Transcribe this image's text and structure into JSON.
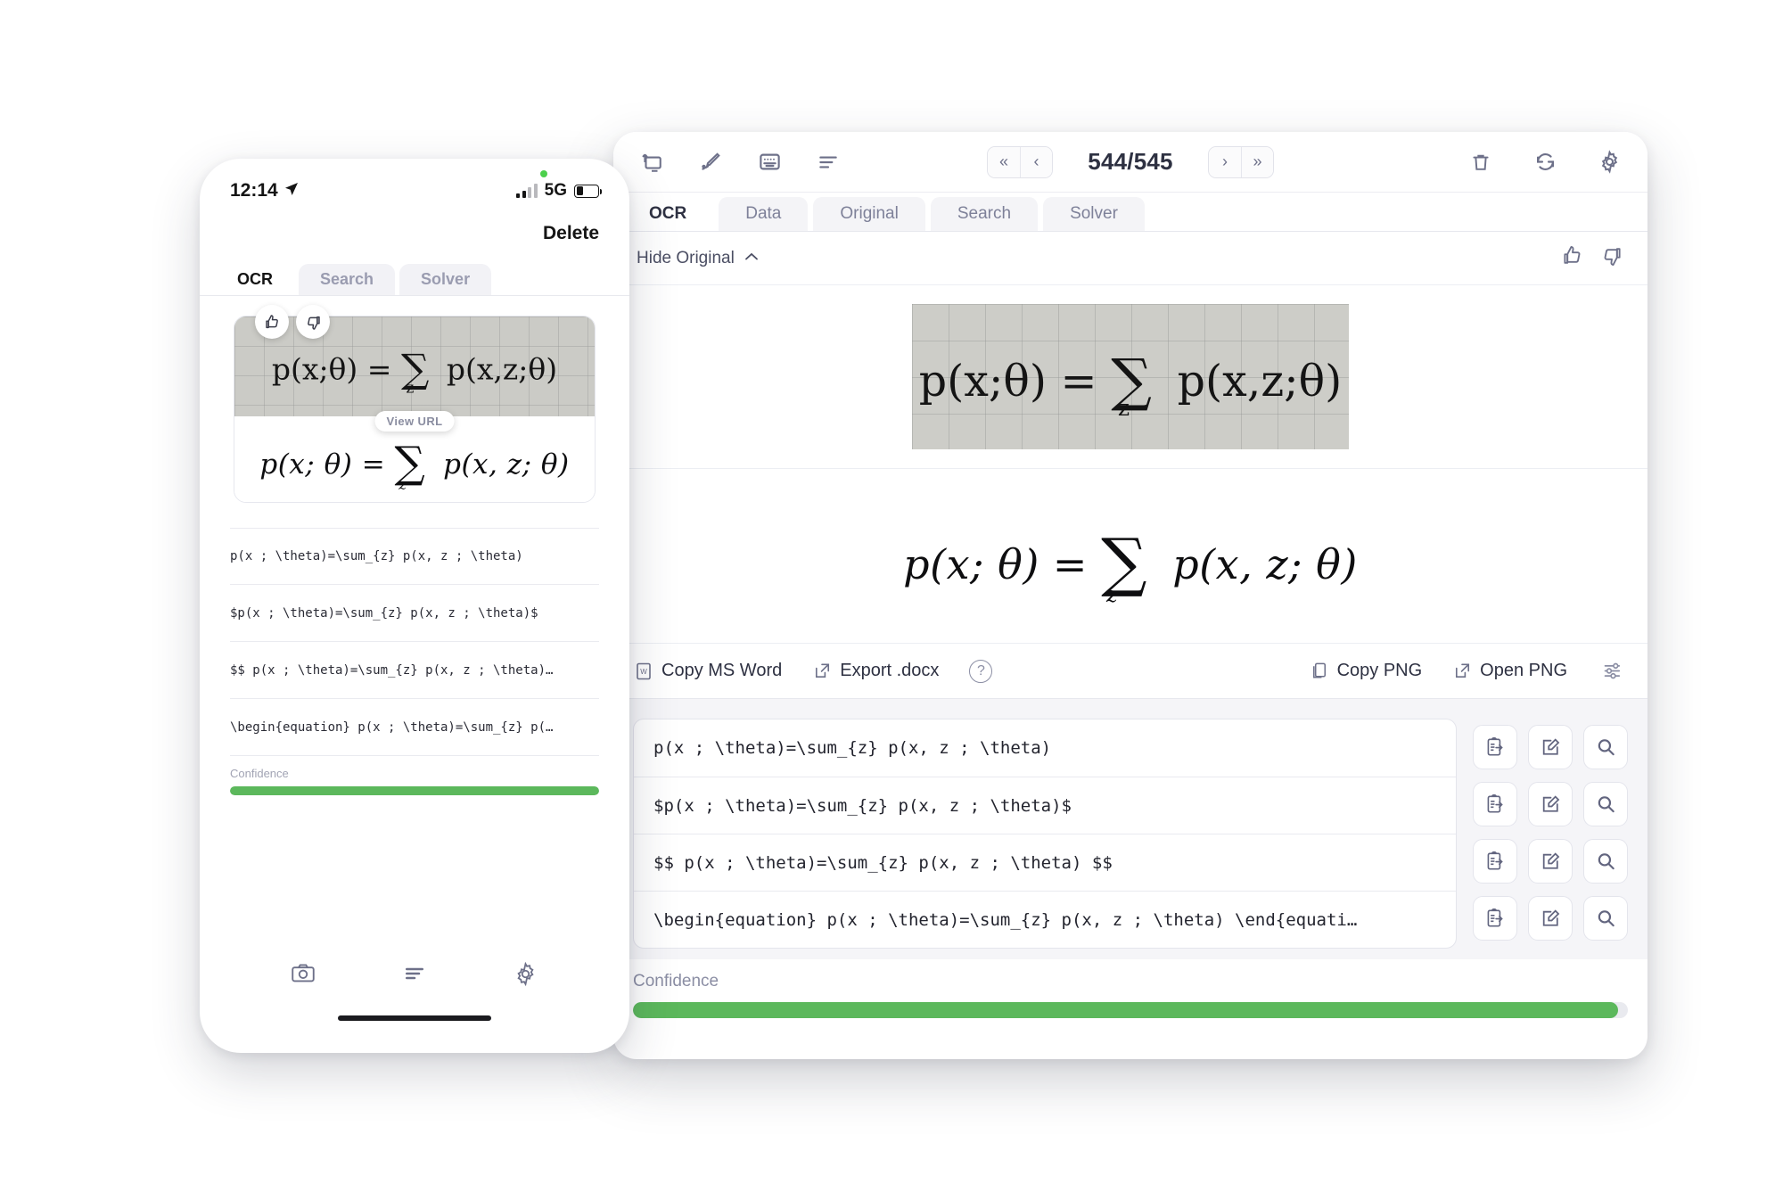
{
  "phone": {
    "status": {
      "time": "12:14",
      "location_icon": "location-arrow-icon",
      "network": "5G"
    },
    "delete_label": "Delete",
    "tabs": [
      {
        "label": "OCR",
        "active": true
      },
      {
        "label": "Search",
        "active": false
      },
      {
        "label": "Solver",
        "active": false
      }
    ],
    "vote": {
      "up": "thumbs-up-icon",
      "down": "thumbs-down-icon"
    },
    "tooltip": {
      "view_url": "View URL"
    },
    "equation": {
      "handwritten": "p(x;θ) = ∑ p(x,z;θ)",
      "rendered_lhs": "p(x; θ) =",
      "rendered_sum": "∑",
      "rendered_sub": "z",
      "rendered_rhs": "p(x, z; θ)"
    },
    "results": [
      "p(x ; \\theta)=\\sum_{z} p(x, z ; \\theta)",
      "$p(x ; \\theta)=\\sum_{z} p(x, z ; \\theta)$",
      "$$ p(x ; \\theta)=\\sum_{z} p(x, z ; \\theta)…",
      "\\begin{equation} p(x ; \\theta)=\\sum_{z} p(…"
    ],
    "confidence": {
      "label": "Confidence",
      "percent": 100
    },
    "bottom_nav": [
      {
        "icon": "camera-icon"
      },
      {
        "icon": "list-icon"
      },
      {
        "icon": "gear-icon"
      }
    ]
  },
  "tablet": {
    "toolbar": {
      "left_icons": [
        "import-to-screen-icon",
        "pen-icon",
        "keyboard-icon",
        "list-icon"
      ],
      "right_icons": [
        "trash-icon",
        "refresh-icon",
        "gear-icon"
      ],
      "pager": {
        "first_label": "«",
        "prev_label": "‹",
        "next_label": "›",
        "last_label": "»",
        "count": "544/545"
      }
    },
    "tabs": [
      {
        "label": "OCR",
        "active": true
      },
      {
        "label": "Data",
        "active": false
      },
      {
        "label": "Original",
        "active": false
      },
      {
        "label": "Search",
        "active": false
      },
      {
        "label": "Solver",
        "active": false
      }
    ],
    "hide_original": {
      "label": "Hide Original",
      "chevron": "chevron-up-icon"
    },
    "vote": {
      "up": "thumbs-up-icon",
      "down": "thumbs-down-icon"
    },
    "equation": {
      "handwritten": "p(x;θ) = ∑ p(x,z;θ)",
      "rendered_lhs": "p(x; θ) =",
      "rendered_sum": "∑",
      "rendered_sub": "z",
      "rendered_rhs": "p(x, z; θ)"
    },
    "actions": {
      "copy_ms_word": "Copy MS Word",
      "export_docx": "Export .docx",
      "help": "?",
      "copy_png": "Copy PNG",
      "open_png": "Open PNG",
      "settings_icon": "sliders-icon"
    },
    "results": [
      "p(x ; \\theta)=\\sum_{z} p(x, z ; \\theta)",
      "$p(x ; \\theta)=\\sum_{z} p(x, z ; \\theta)$",
      "$$ p(x ; \\theta)=\\sum_{z} p(x, z ; \\theta) $$",
      "\\begin{equation} p(x ; \\theta)=\\sum_{z} p(x, z ; \\theta) \\end{equati…"
    ],
    "row_actions": [
      "paste-clipboard-icon",
      "edit-square-icon",
      "search-icon"
    ],
    "confidence": {
      "label": "Confidence",
      "percent": 99
    }
  }
}
